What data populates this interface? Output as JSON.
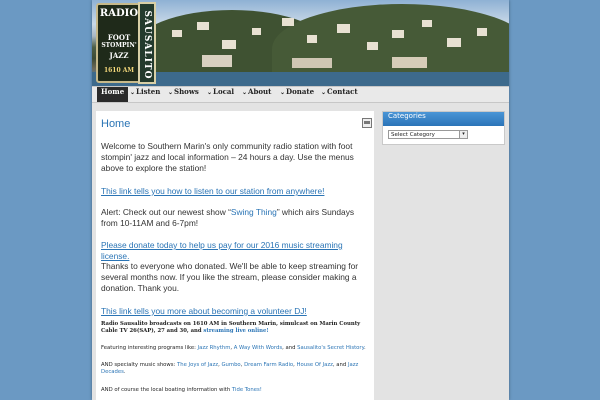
{
  "header": {
    "sign_lines": [
      "RADIO",
      "FOOT",
      "STOMPIN'",
      "JAZZ",
      "1610 AM"
    ],
    "vertical_sign": "SAUSALITO"
  },
  "nav": {
    "items": [
      {
        "label": "Home",
        "active": true,
        "chevron": false
      },
      {
        "label": "Listen",
        "chevron": true
      },
      {
        "label": "Shows",
        "chevron": true
      },
      {
        "label": "Local",
        "chevron": true
      },
      {
        "label": "About",
        "chevron": true
      },
      {
        "label": "Donate",
        "chevron": true
      },
      {
        "label": "Contact",
        "chevron": true
      }
    ]
  },
  "main": {
    "title": "Home",
    "intro": "Welcome to Southern Marin's only community radio station with foot stompin' jazz and local information –  24 hours a day. Use the menus above to explore the station!",
    "listen_link": "This link tells you how to listen to our station from anywhere!",
    "alert_pre": "Alert: Check out our newest show “",
    "alert_show": "Swing Thing",
    "alert_post": "” which airs Sundays from 10-11AM and 6-7pm!",
    "donate_link": "Please donate today to help us pay for our 2016 music streaming license.",
    "thanks": "Thanks to everyone who donated. We'll be able to keep streaming for several months now. If you like the stream, please consider making a donation. Thank you.",
    "volunteer_link": "This link tells you more about becoming a volunteer DJ!",
    "broadcast_text": "Radio Sausalito broadcasts on 1610 AM in Southern Marin, simulcast on Marin County Cable TV 26(SAP), 27 and 30, and ",
    "broadcast_link": "streaming live online!",
    "programs_pre": "Featuring interesting programs like: ",
    "programs": [
      "Jazz Rhythm",
      "A Way With Words",
      "Sausalito's Secret History"
    ],
    "programs_and": ", and ",
    "specialty_pre": "AND specialty music shows: ",
    "specialty": [
      "The Joys of Jazz",
      "Gumbo",
      "Dream Farm Radio",
      "House Of Jazz",
      "Jazz Decades"
    ],
    "boating_pre": "AND of course the local boating information with ",
    "boating_link": "Tide Tones!"
  },
  "sidebar": {
    "heading": "Categories",
    "select_value": "Select Category"
  },
  "colors": {
    "background": "#6b99c3",
    "link": "#2a74b5",
    "nav_active": "#2b2b2b"
  }
}
